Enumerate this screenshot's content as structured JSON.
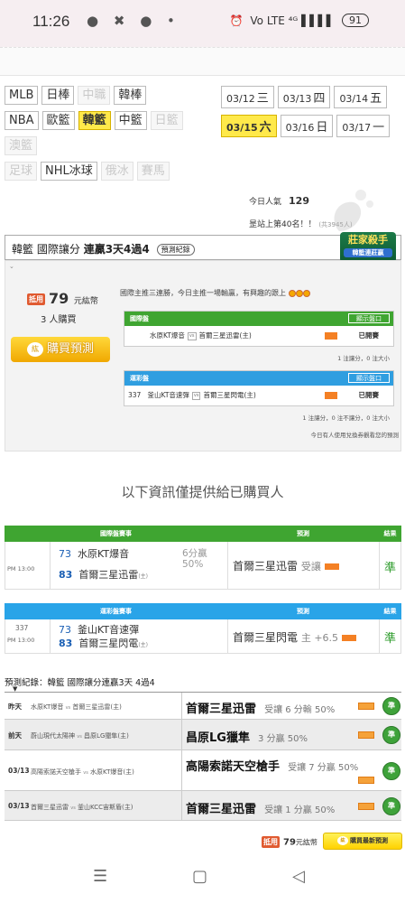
{
  "status_bar": {
    "time": "11:26",
    "left_icons": "● ✖ ● •",
    "signal": "Vo LTE ⁴ᴳ ▌▌▌▌",
    "battery": "91"
  },
  "leagues": [
    [
      {
        "label": "MLB",
        "state": "normal"
      },
      {
        "label": "日棒",
        "state": "normal"
      },
      {
        "label": "中職",
        "state": "dim"
      },
      {
        "label": "韓棒",
        "state": "normal"
      }
    ],
    [
      {
        "label": "NBA",
        "state": "normal"
      },
      {
        "label": "歐籃",
        "state": "normal"
      },
      {
        "label": "韓籃",
        "state": "active"
      },
      {
        "label": "中籃",
        "state": "normal"
      },
      {
        "label": "日籃",
        "state": "dim"
      }
    ],
    [
      {
        "label": "澳籃",
        "state": "dim"
      }
    ],
    [
      {
        "label": "足球",
        "state": "dim"
      },
      {
        "label": "NHL冰球",
        "state": "normal"
      },
      {
        "label": "俄冰",
        "state": "dim"
      },
      {
        "label": "賽馬",
        "state": "dim"
      }
    ]
  ],
  "dates": [
    [
      {
        "date": "03/12",
        "day": "三",
        "active": false
      },
      {
        "date": "03/13",
        "day": "四",
        "active": false
      },
      {
        "date": "03/14",
        "day": "五",
        "active": false
      }
    ],
    [
      {
        "date": "03/15",
        "day": "六",
        "active": true
      },
      {
        "date": "03/16",
        "day": "日",
        "active": false
      },
      {
        "date": "03/17",
        "day": "一",
        "active": false
      }
    ]
  ],
  "popularity": {
    "label": "今日人氣",
    "value": "129"
  },
  "rank": {
    "text": "昰站上第40名！！",
    "note": "(共3945人)"
  },
  "card": {
    "league": "韓籃",
    "market": "國際讓分",
    "streak": "連贏3天4過4",
    "record_button": "預測紀錄",
    "badge_title": "莊家殺手",
    "badge_sub": "韓籃連莊嬴"
  },
  "price": {
    "coin_label": "抵用",
    "amount": "79",
    "unit": "元紘幣"
  },
  "buyers": "3 人購買",
  "buy_button": "購買預測",
  "host_note": "國際主推三連勝，今日主推一場輸贏，有興趣的跟上",
  "intl_box": {
    "title": "國際盤",
    "show_label": "顯示盤口",
    "home": "水原KT爆音",
    "vs": "vs",
    "away": "首爾三星迅雷(主)",
    "status": "已開賽",
    "note": "1 注讓分，0 注大小"
  },
  "lottery_box": {
    "title": "運彩盤",
    "show_label": "顯示盤口",
    "code": "337",
    "home": "釜山KT音速彈",
    "vs": "vs",
    "away": "首爾三星閃電(主)",
    "status": "已開賽",
    "note": "1 注讓分，0 注不讓分，0 注大小",
    "note2": "今日有人使用兌換券觀看您的預測"
  },
  "buyer_only": "以下資訊僅提供給已購買人",
  "intl_table": {
    "headers": [
      "國際盤賽事",
      "預測",
      "結果"
    ],
    "time": "PM 13:00",
    "home_no": "73",
    "home": "水原KT爆音",
    "away_no": "83",
    "away": "首爾三星迅雷",
    "home_tag": "(主)",
    "line1": "6分贏",
    "line2": "50%",
    "pick": "首爾三星迅雷",
    "pick_type": "受讓",
    "result": "準"
  },
  "lottery_table": {
    "headers": [
      "運彩盤賽事",
      "預測",
      "結果"
    ],
    "code": "337",
    "time": "PM 13:00",
    "home_no": "73",
    "home": "釜山KT音速彈",
    "away_no": "83",
    "away": "首爾三星閃電",
    "home_tag": "(主)",
    "pick": "首爾三星閃電",
    "pick_type": "主 +6.5",
    "result": "準"
  },
  "records": {
    "title": "預測紀錄：韓籃 國際讓分連贏3天 4過4",
    "rows": [
      {
        "day": "昨天",
        "a": "水原KT爆音",
        "vs": "vs",
        "b": "首爾三星迅雷(主)",
        "pick": "首爾三星迅雷",
        "detail": "受讓 6 分輸 50%",
        "result": "準"
      },
      {
        "day": "前天",
        "a": "蔚山現代太陽神",
        "vs": "vs",
        "b": "昌原LG獵隼(主)",
        "pick": "昌原LG獵隼",
        "detail": "3 分贏 50%",
        "result": "準"
      },
      {
        "day": "03/13",
        "a": "高陽索諾天空槍手",
        "vs": "vs",
        "b": "水原KT爆音(主)",
        "pick": "高陽索諾天空槍手",
        "detail": "受讓 7 分贏 50%",
        "result": "準"
      },
      {
        "day": "03/13",
        "a": "首爾三星迅雷",
        "vs": "vs",
        "b": "釜山KCC宙斯盾(主)",
        "pick": "首爾三星迅雷",
        "detail": "受讓 1 分贏 50%",
        "result": "準"
      }
    ]
  },
  "footer": {
    "coin_label": "抵用",
    "amount": "79",
    "unit": "元紘幣",
    "buy_label": "購買最新預測"
  },
  "nav": {
    "menu": "☰",
    "home": "▢",
    "back": "◁"
  },
  "colors": {
    "accent_yellow": "#ffe94a",
    "green": "#3fa531",
    "blue": "#29a4e8"
  }
}
